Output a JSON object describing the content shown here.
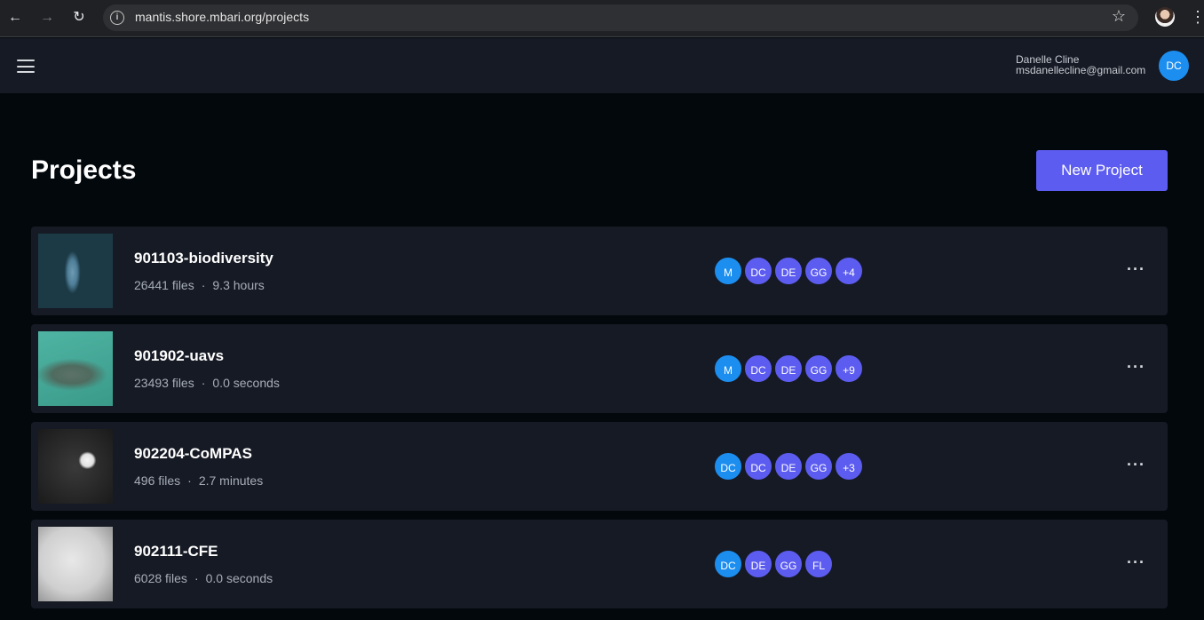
{
  "browser": {
    "url": "mantis.shore.mbari.org/projects"
  },
  "header": {
    "user_name": "Danelle Cline",
    "user_email": "msdanellecline@gmail.com",
    "user_initials": "DC"
  },
  "main": {
    "title": "Projects",
    "new_project_label": "New Project"
  },
  "projects": [
    {
      "name": "901103-biodiversity",
      "files": "26441 files",
      "duration": "9.3 hours",
      "members": [
        "M",
        "DC",
        "DE",
        "GG",
        "+4"
      ]
    },
    {
      "name": "901902-uavs",
      "files": "23493 files",
      "duration": "0.0 seconds",
      "members": [
        "M",
        "DC",
        "DE",
        "GG",
        "+9"
      ]
    },
    {
      "name": "902204-CoMPAS",
      "files": "496 files",
      "duration": "2.7 minutes",
      "members": [
        "DC",
        "DC",
        "DE",
        "GG",
        "+3"
      ]
    },
    {
      "name": "902111-CFE",
      "files": "6028 files",
      "duration": "0.0 seconds",
      "members": [
        "DC",
        "DE",
        "GG",
        "FL"
      ]
    }
  ],
  "colors": {
    "accent": "#5c5cf0",
    "avatar_blue": "#1c8ef0",
    "background": "#03080d",
    "card": "#161a24"
  }
}
